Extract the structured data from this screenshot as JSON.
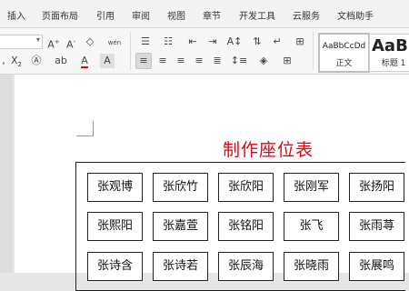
{
  "menu": {
    "tabs": [
      "插入",
      "页面布局",
      "引用",
      "审阅",
      "视图",
      "章节",
      "开发工具",
      "云服务",
      "文档助手"
    ]
  },
  "ribbon": {
    "styles": [
      {
        "sample": "AaBbCcDd",
        "name": "正文"
      },
      {
        "sample": "AaBb",
        "name": "标题 1"
      }
    ]
  },
  "document": {
    "title": "制作座位表",
    "title_color": "#e60012",
    "seats": [
      [
        "张观博",
        "张欣竹",
        "张欣阳",
        "张刚军",
        "张扬阳"
      ],
      [
        "张熙阳",
        "张嘉萱",
        "张铭阳",
        "张飞",
        "张雨荨"
      ],
      [
        "张诗含",
        "张诗若",
        "张辰海",
        "张晓雨",
        "张展鸣"
      ]
    ]
  }
}
